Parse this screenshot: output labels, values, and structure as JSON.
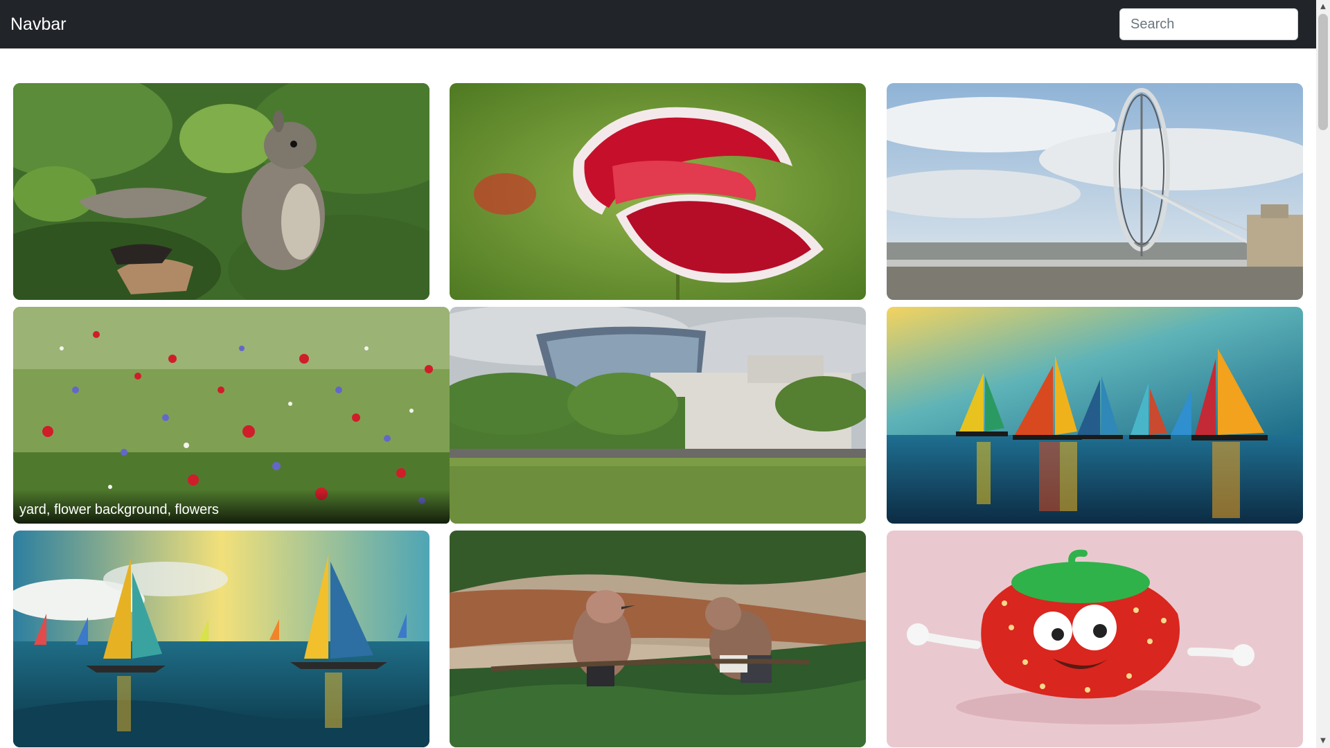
{
  "navbar": {
    "brand": "Navbar",
    "search_placeholder": "Search",
    "search_value": ""
  },
  "gallery": {
    "items": [
      {
        "subject": "squirrel",
        "caption": ""
      },
      {
        "subject": "red-white-flower",
        "caption": ""
      },
      {
        "subject": "ferris-wheel",
        "caption": ""
      },
      {
        "subject": "wildflower-meadow",
        "caption": "yard, flower background, flowers"
      },
      {
        "subject": "city-buildings-park",
        "caption": ""
      },
      {
        "subject": "colorful-sailboats",
        "caption": ""
      },
      {
        "subject": "sailboats-sunset",
        "caption": ""
      },
      {
        "subject": "birds-on-branch",
        "caption": ""
      },
      {
        "subject": "strawberry-cartoon",
        "caption": ""
      }
    ]
  },
  "colors": {
    "navbar_bg": "#212529",
    "page_bg": "#ffffff"
  }
}
